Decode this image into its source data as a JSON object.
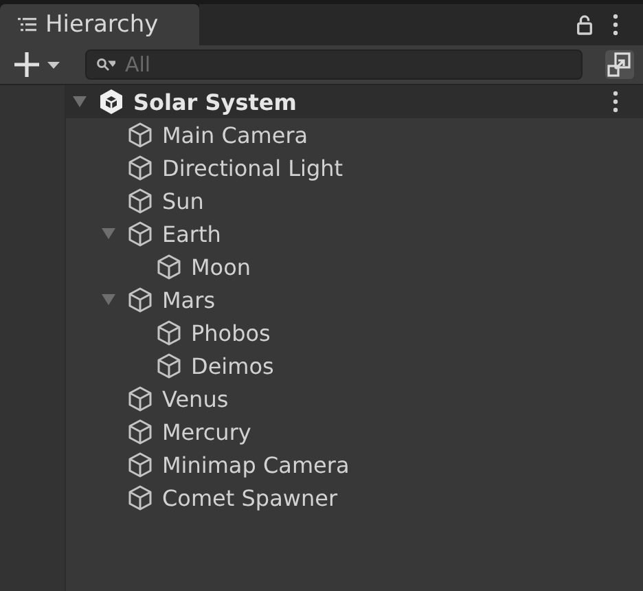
{
  "tab": {
    "title": "Hierarchy",
    "selected": true
  },
  "search": {
    "placeholder": "All"
  },
  "scene": {
    "name": "Solar System",
    "expanded": true,
    "children": [
      {
        "name": "Main Camera"
      },
      {
        "name": "Directional Light"
      },
      {
        "name": "Sun"
      },
      {
        "name": "Earth",
        "expanded": true,
        "children": [
          {
            "name": "Moon"
          }
        ]
      },
      {
        "name": "Mars",
        "expanded": true,
        "children": [
          {
            "name": "Phobos"
          },
          {
            "name": "Deimos"
          }
        ]
      },
      {
        "name": "Venus"
      },
      {
        "name": "Mercury"
      },
      {
        "name": "Minimap Camera"
      },
      {
        "name": "Comet Spawner"
      }
    ]
  }
}
